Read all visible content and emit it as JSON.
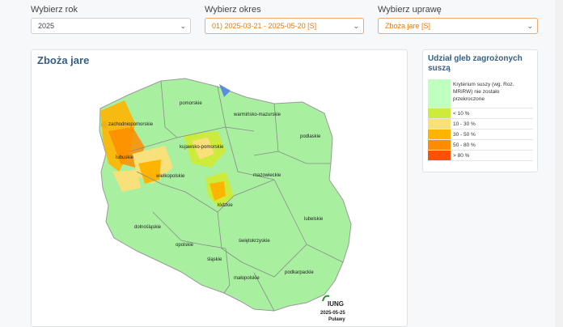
{
  "filters": {
    "year": {
      "label": "Wybierz rok",
      "value": "2025"
    },
    "period": {
      "label": "Wybierz okres",
      "value": "01) 2025-03-21 - 2025-05-20 [S]"
    },
    "crop": {
      "label": "Wybierz uprawę",
      "value": "Zboża jare [S]"
    }
  },
  "map": {
    "title": "Zboża jare",
    "regions": [
      "pomorskie",
      "warmińsko-mazurskie",
      "zachodniopomorskie",
      "podlaskie",
      "kujawsko-pomorskie",
      "lubuskie",
      "wielkopolskie",
      "mazowieckie",
      "łódzkie",
      "lubelskie",
      "dolnośląskie",
      "opolskie",
      "świętokrzyskie",
      "śląskie",
      "małopolskie",
      "podkarpackie"
    ],
    "logo": "IUNG",
    "date": "2025-05-25",
    "place": "Puławy"
  },
  "legend": {
    "title": "Udział gleb zagrożonych suszą",
    "items": [
      {
        "label": "Kryterium suszy (wg. Roz. MRiRW) nie zostało przekroczone",
        "color": "#bfffbf"
      },
      {
        "label": "< 10 %",
        "color": "#cdeb3c"
      },
      {
        "label": "10 - 30 %",
        "color": "#f8e07a"
      },
      {
        "label": "30 - 50 %",
        "color": "#ffb400"
      },
      {
        "label": "50 - 80 %",
        "color": "#ff8c00"
      },
      {
        "label": "> 80 %",
        "color": "#ff5000"
      }
    ]
  }
}
